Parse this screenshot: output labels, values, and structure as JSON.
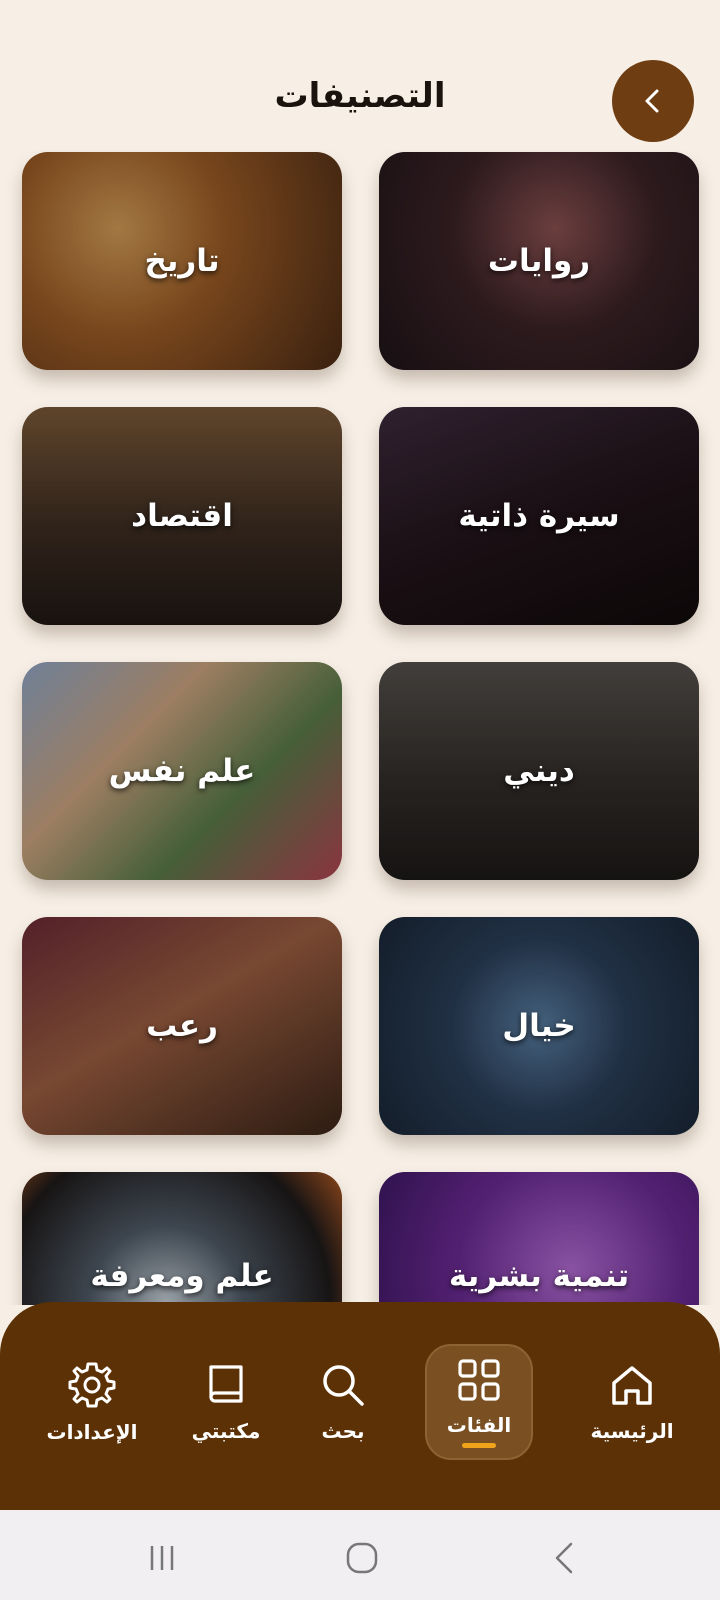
{
  "header": {
    "title": "التصنيفات",
    "back_icon": "chevron-left-icon"
  },
  "categories": [
    {
      "label": "روايات",
      "icon": "novels-cover"
    },
    {
      "label": "تاريخ",
      "icon": "history-cover"
    },
    {
      "label": "سيرة ذاتية",
      "icon": "biography-cover"
    },
    {
      "label": "اقتصاد",
      "icon": "economy-cover"
    },
    {
      "label": "ديني",
      "icon": "religious-cover"
    },
    {
      "label": "علم نفس",
      "icon": "psychology-cover"
    },
    {
      "label": "خيال",
      "icon": "fantasy-cover"
    },
    {
      "label": "رعب",
      "icon": "horror-cover"
    },
    {
      "label": "تنمية بشرية",
      "icon": "self-development-cover"
    },
    {
      "label": "علم ومعرفة",
      "icon": "science-cover"
    }
  ],
  "nav": {
    "items": [
      {
        "label": "الرئيسية",
        "icon": "home-icon"
      },
      {
        "label": "الفئات",
        "icon": "grid-icon",
        "active": true
      },
      {
        "label": "بحث",
        "icon": "search-icon"
      },
      {
        "label": "مكتبتي",
        "icon": "book-icon"
      },
      {
        "label": "الإعدادات",
        "icon": "gear-icon"
      }
    ]
  },
  "colors": {
    "background": "#f7efe6",
    "brand_brown": "#5c3106",
    "back_button": "#6f3d12",
    "active_indicator": "#f2a31c"
  }
}
